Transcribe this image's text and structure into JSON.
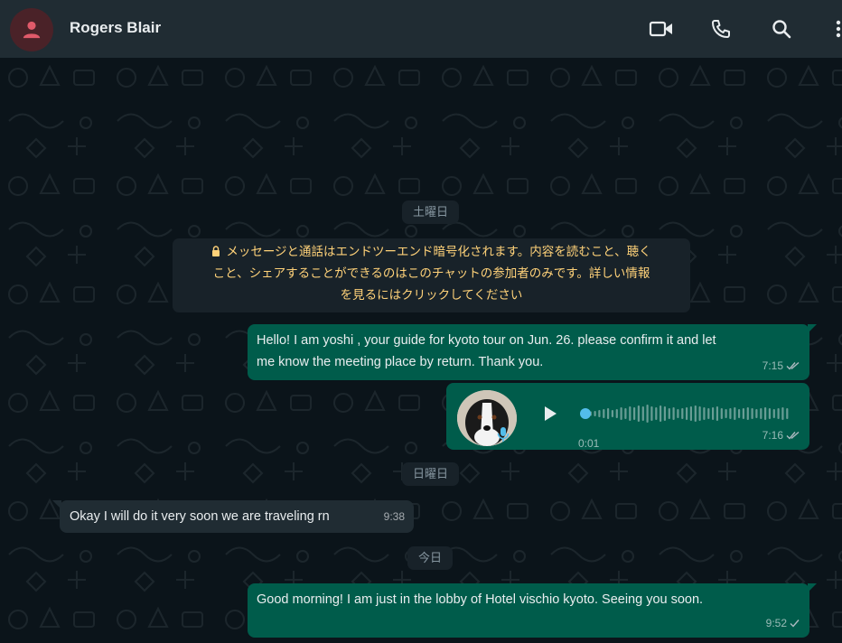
{
  "header": {
    "contact_name": "Rogers Blair",
    "avatar_icon": "person-icon",
    "actions": [
      {
        "icon": "video-call-icon"
      },
      {
        "icon": "phone-call-icon"
      },
      {
        "icon": "search-icon"
      },
      {
        "icon": "more-menu-icon"
      }
    ]
  },
  "colors": {
    "header_bg": "#202c33",
    "chat_bg": "#0b141a",
    "outgoing_bubble": "#005c4b",
    "incoming_bubble": "#202c33",
    "encryption_text": "#ffd279",
    "avatar_accent": "#e05a6a",
    "voice_progress": "#53bdeb"
  },
  "chat": {
    "date_saturday": "土曜日",
    "encryption_notice_lines": [
      "メッセージと通話はエンドツーエンド暗号化されます。内容を読むこと、聴く",
      "こと、シェアすることができるのはこのチャットの参加者のみです。詳しい情報",
      "を見るにはクリックしてください"
    ],
    "encryption_icon": "lock-icon",
    "msg1": {
      "lines": [
        "Hello! I am yoshi , your guide for kyoto tour on Jun. 26. please confirm it and let",
        "me know the meeting place by return. Thank you."
      ],
      "time": "7:15",
      "status": "read"
    },
    "voice": {
      "duration": "0:01",
      "time": "7:16",
      "status": "read",
      "progress": 0.0
    },
    "date_sunday": "日曜日",
    "msg2": {
      "text": "Okay I will do it very soon we are traveling rn",
      "time": "9:38"
    },
    "date_today": "今日",
    "msg3": {
      "text": "Good morning! I am just in the lobby of Hotel vischio kyoto. Seeing you soon.",
      "time": "9:52",
      "status": "sent"
    }
  }
}
